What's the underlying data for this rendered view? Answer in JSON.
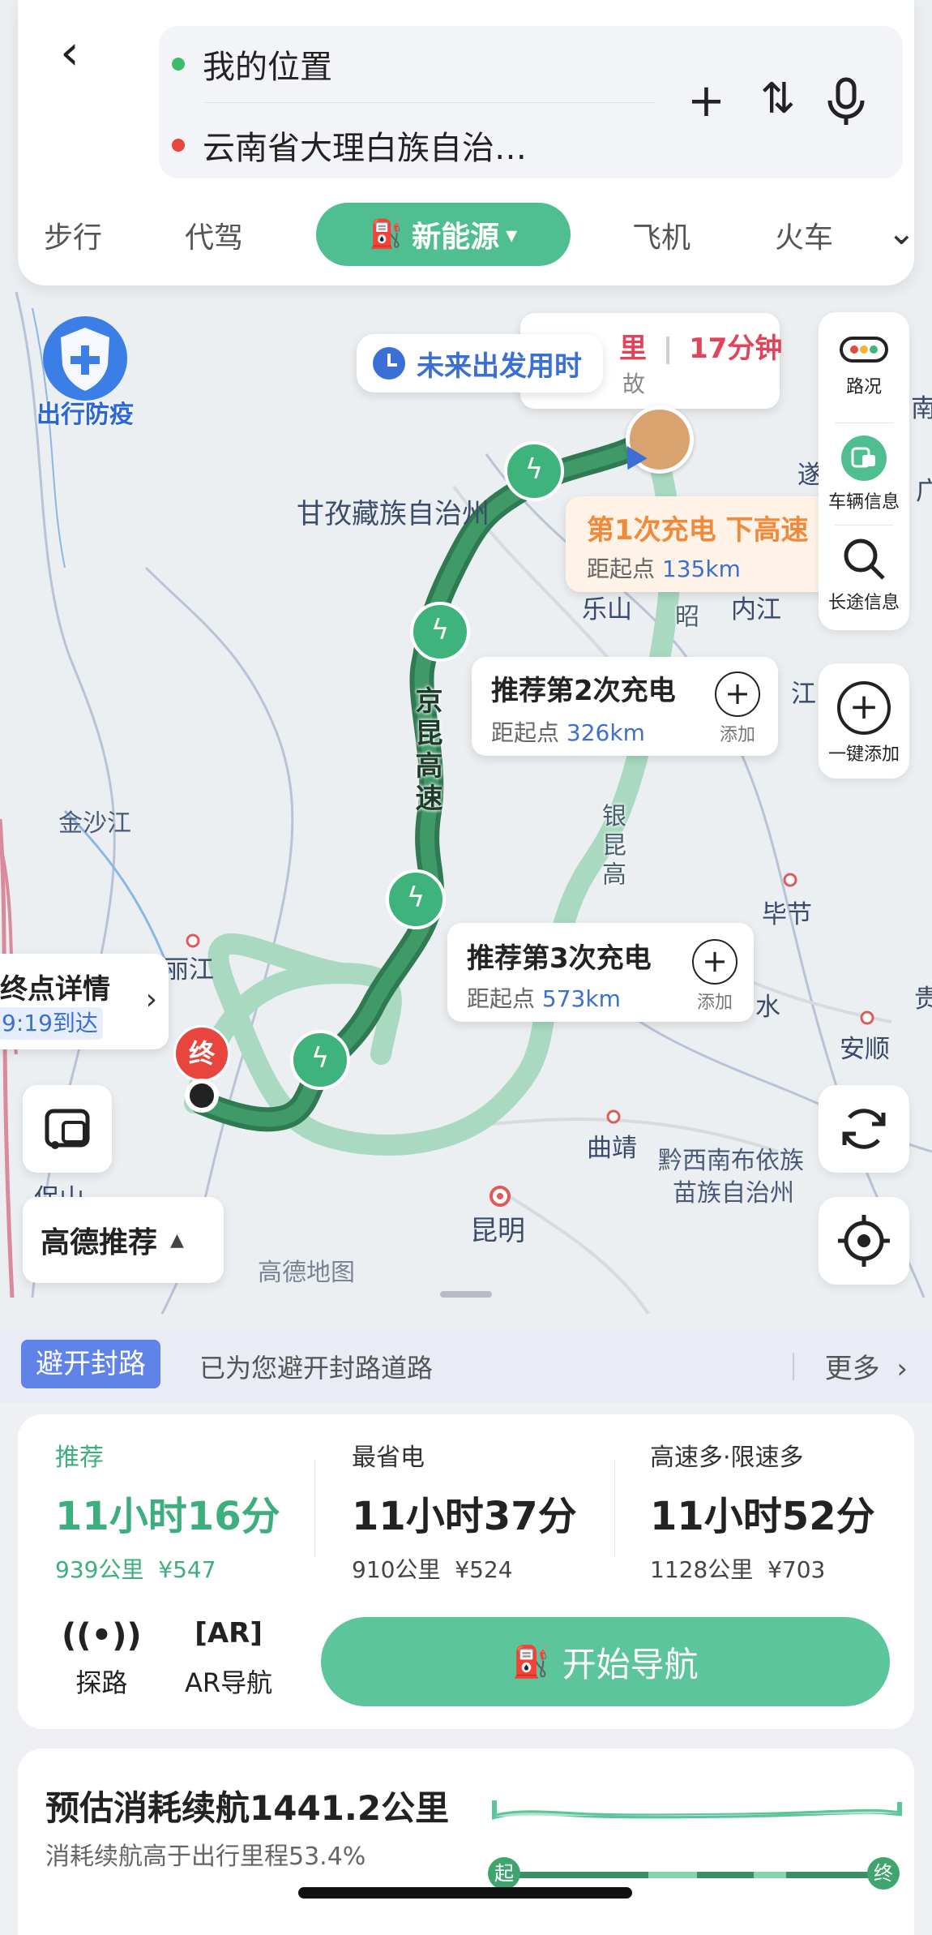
{
  "header": {
    "back_label": "‹",
    "origin": "我的位置",
    "destination": "云南省大理白族自治…",
    "add_icon": "+",
    "swap_icon": "⇅",
    "mic_icon": "mic-icon"
  },
  "modes": {
    "items": [
      "步行",
      "代驾",
      "飞机",
      "火车"
    ],
    "active": "新能源",
    "active_caret": "▾"
  },
  "map": {
    "labels": {
      "ganzi": "甘孜藏族自治州",
      "jinsha": "金沙江",
      "lijiang": "丽江",
      "kunming": "昆明",
      "qujing": "曲靖",
      "qianxinan": "黔西南布依族",
      "qianxinan2": "苗族自治州",
      "bijie": "毕节",
      "anshun": "安顺",
      "leshan": "乐山",
      "neijiang": "内江",
      "baoshan": "保山",
      "gaode_map": "高德地图",
      "sui": "遂",
      "jiang": "江",
      "shui": "水",
      "gui": "贵",
      "nan": "南",
      "guang": "广"
    },
    "roads": {
      "jingkun": "京昆高速",
      "yinkun": "银昆高",
      "zhao": "昭"
    },
    "epidemic_badge": "出行防疫",
    "future_departure": "未来出发用时",
    "eta_bubble": {
      "left": "里",
      "time": "17分钟",
      "sub": "故"
    },
    "charge1": {
      "title": "第1次充电 下高速",
      "dist_label": "距起点",
      "dist_value": "135km"
    },
    "charge2": {
      "title": "推荐第2次充电",
      "dist_label": "距起点",
      "dist_value": "326km",
      "add_label": "添加"
    },
    "charge3": {
      "title": "推荐第3次充电",
      "dist_label": "距起点",
      "dist_value": "573km",
      "add_label": "添加"
    },
    "end_detail": {
      "title": "终点详情",
      "arrive": "9:19到达"
    },
    "end_marker": "终",
    "route_pref": "高德推荐",
    "route_pref_caret": "▲"
  },
  "rail": {
    "traffic": "路况",
    "vehicle": "车辆信息",
    "longtrip": "长途信息",
    "oneclick": "一键添加"
  },
  "avoid": {
    "badge": "避开封路",
    "text": "已为您避开封路道路",
    "more": "更多"
  },
  "plans": [
    {
      "label": "推荐",
      "time": "11小时16分",
      "dist": "939公里",
      "cost": "¥547"
    },
    {
      "label": "最省电",
      "time": "11小时37分",
      "dist": "910公里",
      "cost": "¥524"
    },
    {
      "label": "高速多·限速多",
      "time": "11小时52分",
      "dist": "1128公里",
      "cost": "¥703"
    }
  ],
  "tools": {
    "explore": "探路",
    "ar": "AR导航",
    "start_nav": "开始导航"
  },
  "range": {
    "title": "预估消耗续航1441.2公里",
    "sub": "消耗续航高于出行里程53.4%",
    "start": "起",
    "end": "终"
  },
  "colors": {
    "accent": "#4fbf91",
    "route": "#2f7a52",
    "link": "#3b6fd4",
    "warn": "#e45a4a"
  }
}
